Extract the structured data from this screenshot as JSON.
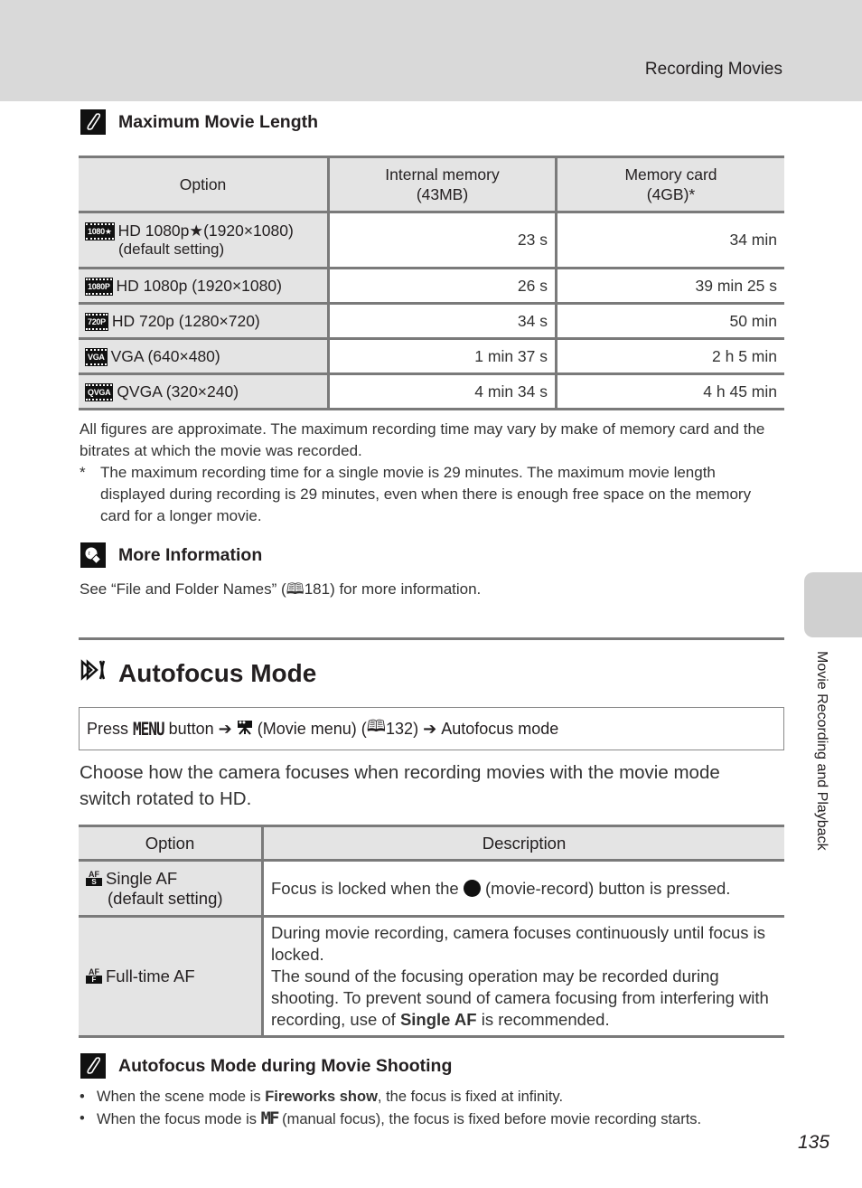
{
  "header": {
    "running_head": "Recording Movies"
  },
  "side_tab": {
    "label": "Movie Recording and Playback"
  },
  "max_length_note": {
    "icon": "pencil-note-icon",
    "title": "Maximum Movie Length",
    "table": {
      "headers": {
        "option": "Option",
        "internal_line1": "Internal memory",
        "internal_line2": "(43MB)",
        "card_line1": "Memory card",
        "card_line2": "(4GB)*"
      },
      "rows": [
        {
          "icon": "1080★",
          "option": "HD 1080p★(1920×1080)",
          "sub": "(default setting)",
          "internal": "23 s",
          "card": "34 min"
        },
        {
          "icon": "1080P",
          "option": "HD 1080p (1920×1080)",
          "sub": "",
          "internal": "26 s",
          "card": "39 min 25 s"
        },
        {
          "icon": "720P",
          "option": "HD 720p (1280×720)",
          "sub": "",
          "internal": "34 s",
          "card": "50 min"
        },
        {
          "icon": "VGA",
          "option": "VGA (640×480)",
          "sub": "",
          "internal": "1 min 37 s",
          "card": "2 h 5 min"
        },
        {
          "icon": "QVGA",
          "option": "QVGA (320×240)",
          "sub": "",
          "internal": "4 min 34 s",
          "card": "4 h 45 min"
        }
      ]
    },
    "approx_text": "All figures are approximate. The maximum recording time may vary by make of memory card and the bitrates at which the movie was recorded.",
    "footnote_mark": "*",
    "footnote_text": "The maximum recording time for a single movie is 29 minutes. The maximum movie length displayed during recording is 29 minutes, even when there is enough free space on the memory card for a longer movie."
  },
  "more_info": {
    "icon": "lightbulb-icon",
    "title": "More Information",
    "text_before": "See “File and Folder Names” (",
    "page_ref": "181",
    "text_after": ") for more information."
  },
  "autofocus_section": {
    "title_icon": "autofocus-mode-icon",
    "title": "Autofocus Mode",
    "nav": {
      "press": "Press",
      "menu_word": "MENU",
      "button": "button",
      "arrow": "➔",
      "menu_icon": "movie-camera-icon",
      "menu_name": "(Movie menu) (",
      "page_ref": "132",
      "close": ")",
      "target": "Autofocus mode"
    },
    "intro": "Choose how the camera focuses when recording movies with the movie mode switch rotated to HD.",
    "table": {
      "headers": {
        "option": "Option",
        "description": "Description"
      },
      "rows": [
        {
          "icon_top": "AF",
          "icon_bottom": "S",
          "option": "Single AF",
          "sub": "(default setting)",
          "desc_before": "Focus is locked when the",
          "desc_after": "(movie-record) button is pressed."
        },
        {
          "icon_top": "AF",
          "icon_bottom": "F",
          "option": "Full-time AF",
          "desc_line1": "During movie recording, camera focuses continuously until focus is locked.",
          "desc_line2_before": "The sound of the focusing operation may be recorded during shooting. To prevent sound of camera focusing from interfering with recording, use of",
          "desc_bold": "Single AF",
          "desc_line2_after": "is recommended."
        }
      ]
    }
  },
  "af_movie_note": {
    "icon": "pencil-note-icon",
    "title": "Autofocus Mode during Movie Shooting",
    "bullets": [
      {
        "before": "When the scene mode is",
        "bold": "Fireworks show",
        "after": ", the focus is fixed at infinity."
      },
      {
        "before": "When the focus mode is",
        "mf": "MF",
        "after": "(manual focus), the focus is fixed before movie recording starts."
      }
    ]
  },
  "page_number": "135"
}
